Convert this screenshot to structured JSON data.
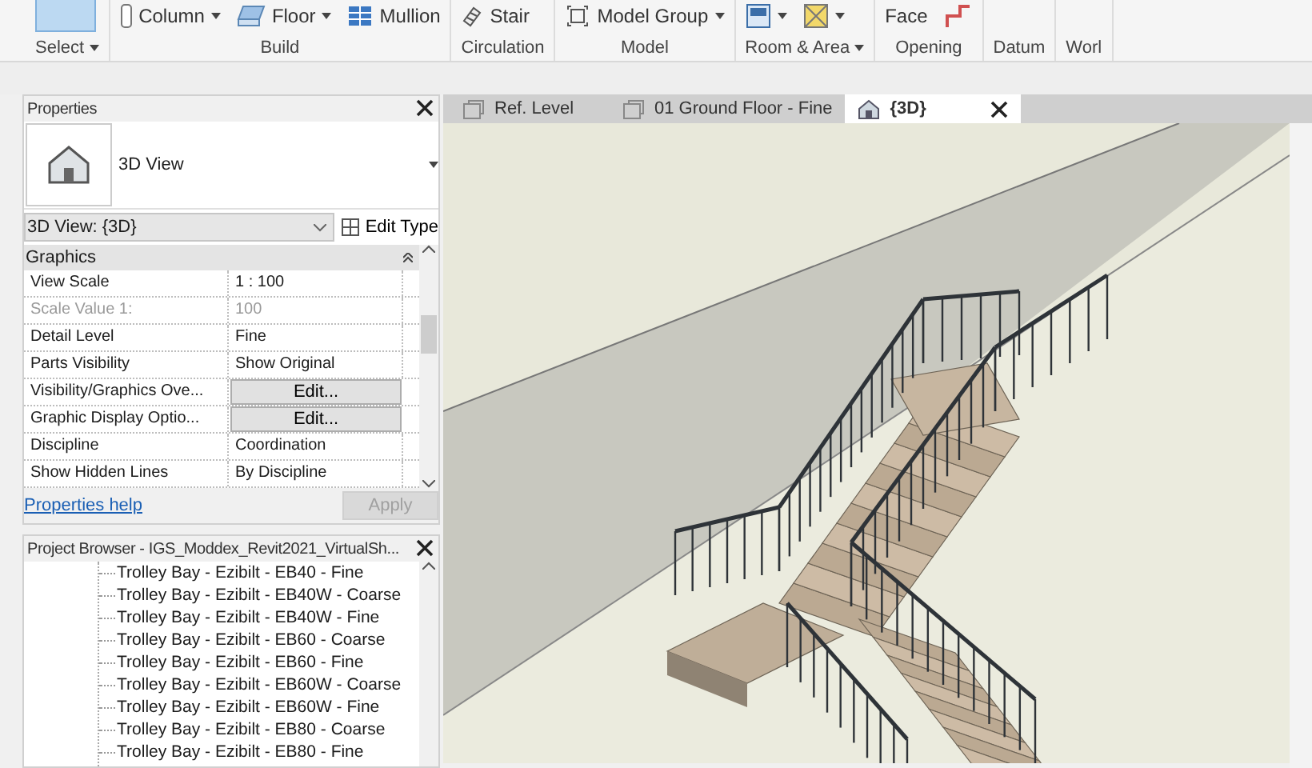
{
  "ribbon": {
    "groups": [
      {
        "label": "Select",
        "dropdown": true
      },
      {
        "label": "Build",
        "dropdown": false,
        "tools": [
          {
            "label": "Column",
            "dropdown": true
          },
          {
            "label": "Floor",
            "dropdown": true
          },
          {
            "label": "Mullion",
            "dropdown": false
          }
        ]
      },
      {
        "label": "Circulation",
        "dropdown": false,
        "tools": [
          {
            "label": "Stair",
            "dropdown": false
          }
        ]
      },
      {
        "label": "Model",
        "dropdown": false,
        "tools": [
          {
            "label": "Model  Group",
            "dropdown": true
          }
        ]
      },
      {
        "label": "Room & Area",
        "dropdown": true,
        "tools": [
          {
            "dropdown": true
          },
          {
            "dropdown": true
          }
        ]
      },
      {
        "label": "Opening",
        "dropdown": false,
        "tools": [
          {
            "label": "Face",
            "dropdown": false
          },
          {
            "dropdown": false
          }
        ]
      },
      {
        "label": "Datum",
        "dropdown": false
      },
      {
        "label": "Worl",
        "dropdown": false
      }
    ]
  },
  "properties": {
    "title": "Properties",
    "type_name": "3D View",
    "instance": "3D View: {3D}",
    "edit_type": "Edit Type",
    "section": "Graphics",
    "rows": [
      {
        "kind": "text",
        "label": "View Scale",
        "value": "1 : 100",
        "disabled": false
      },
      {
        "kind": "text",
        "label": "Scale Value    1:",
        "value": "100",
        "disabled": true
      },
      {
        "kind": "text",
        "label": "Detail Level",
        "value": "Fine",
        "disabled": false
      },
      {
        "kind": "text",
        "label": "Parts Visibility",
        "value": "Show Original",
        "disabled": false
      },
      {
        "kind": "button",
        "label": "Visibility/Graphics Ove...",
        "value": "Edit...",
        "disabled": false
      },
      {
        "kind": "button",
        "label": "Graphic Display Optio...",
        "value": "Edit...",
        "disabled": false
      },
      {
        "kind": "text",
        "label": "Discipline",
        "value": "Coordination",
        "disabled": false
      },
      {
        "kind": "text",
        "label": "Show Hidden Lines",
        "value": "By Discipline",
        "disabled": false
      }
    ],
    "help": "Properties help",
    "apply": {
      "label": "Apply",
      "disabled": true
    }
  },
  "browser": {
    "title": "Project Browser - IGS_Moddex_Revit2021_VirtualSh...",
    "items": [
      "Trolley Bay - Ezibilt - EB40 - Fine",
      "Trolley Bay - Ezibilt - EB40W - Coarse",
      "Trolley Bay - Ezibilt - EB40W - Fine",
      "Trolley Bay - Ezibilt - EB60 - Coarse",
      "Trolley Bay - Ezibilt - EB60 - Fine",
      "Trolley Bay - Ezibilt - EB60W - Coarse",
      "Trolley Bay - Ezibilt - EB60W - Fine",
      "Trolley Bay - Ezibilt - EB80 - Coarse",
      "Trolley Bay - Ezibilt - EB80 - Fine"
    ]
  },
  "view_tabs": [
    {
      "kind": "plan",
      "label": "Ref. Level",
      "selected": false
    },
    {
      "kind": "plan",
      "label": "01 Ground Floor - Fine",
      "selected": false
    },
    {
      "kind": "perspective",
      "label": "{3D}",
      "selected": true
    }
  ]
}
